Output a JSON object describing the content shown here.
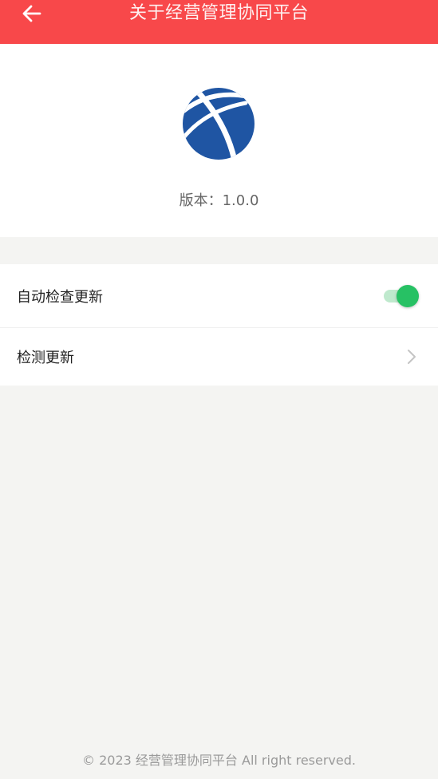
{
  "header": {
    "title": "关于经营管理协同平台",
    "back_icon": "arrow-left-icon"
  },
  "about": {
    "logo_icon": "platform-logo-icon",
    "version_text": "版本：1.0.0"
  },
  "settings": {
    "auto_check": {
      "label": "自动检查更新",
      "enabled": true
    },
    "check_update": {
      "label": "检测更新",
      "icon": "chevron-right-icon"
    }
  },
  "footer": {
    "copyright": "© 2023 经营管理协同平台 All right reserved."
  },
  "colors": {
    "header_bg": "#f8484a",
    "toggle_on": "#27c164",
    "logo_blue": "#1f55a3"
  }
}
